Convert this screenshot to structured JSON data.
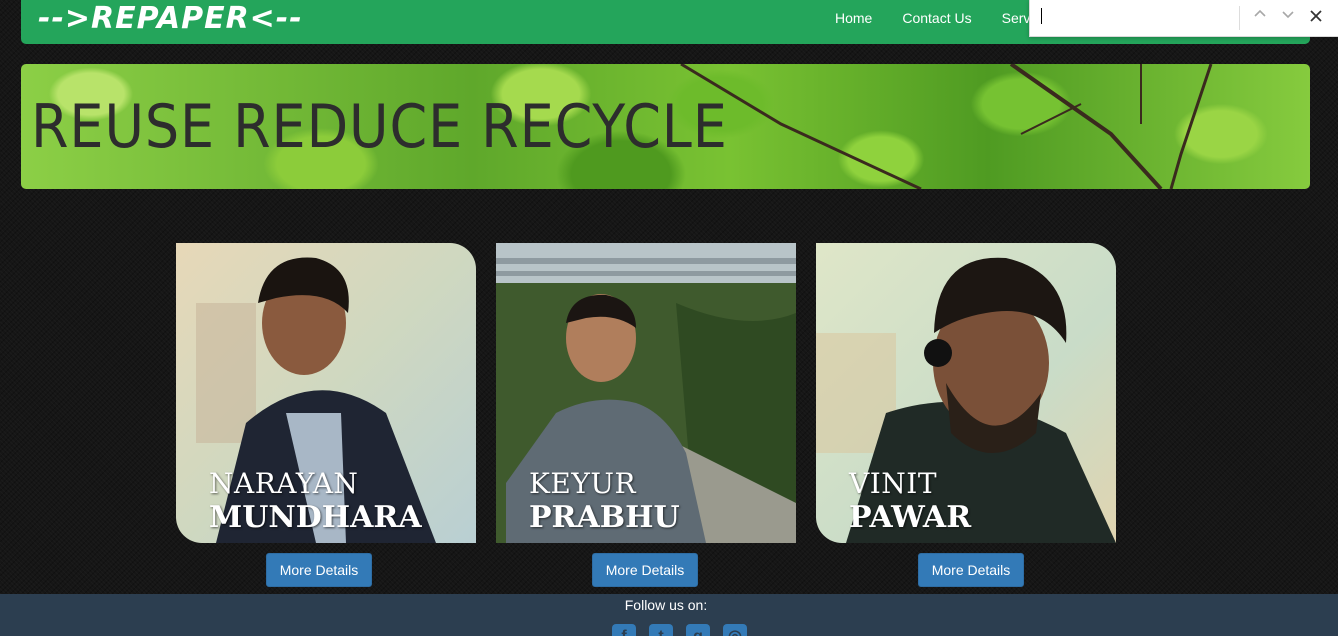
{
  "navbar": {
    "brand": "-->REPAPER<--",
    "links": [
      "Home",
      "Contact Us",
      "Services"
    ]
  },
  "find_bar": {
    "value": "",
    "prev_icon": "chevron-up-icon",
    "next_icon": "chevron-down-icon",
    "close_icon": "close-icon"
  },
  "banner": {
    "title": "REUSE  REDUCE  RECYCLE"
  },
  "team": [
    {
      "first": "NARAYAN",
      "last": "MUNDHARA",
      "button": "More Details"
    },
    {
      "first": "KEYUR",
      "last": "PRABHU",
      "button": "More Details"
    },
    {
      "first": "VINIT",
      "last": "PAWAR",
      "button": "More Details"
    }
  ],
  "footer": {
    "follow": "Follow us on:",
    "social": [
      "facebook-icon",
      "twitter-icon",
      "googleplus-icon",
      "instagram-icon"
    ]
  },
  "colors": {
    "nav_green": "#24a55b",
    "button_blue": "#337ab7",
    "footer_bg": "#2c3e50"
  }
}
